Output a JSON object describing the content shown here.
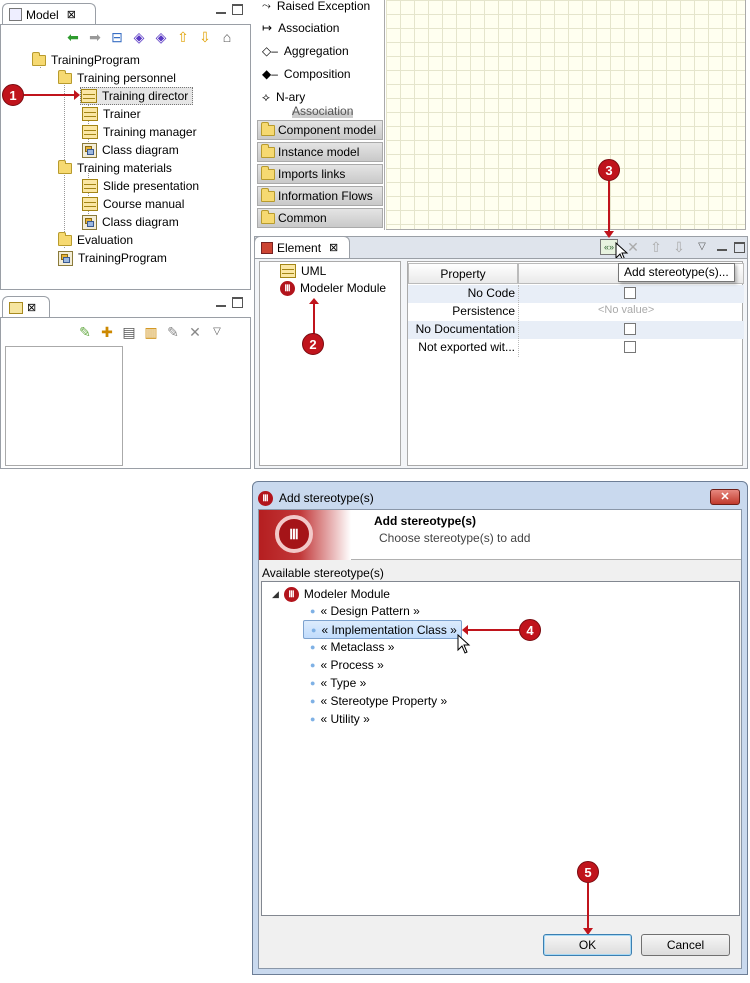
{
  "model_view": {
    "tab_label": "Model",
    "tree": [
      {
        "label": "TrainingProgram",
        "icon": "folder"
      },
      {
        "label": "Training personnel",
        "icon": "folder"
      },
      {
        "label": "Training director",
        "icon": "class"
      },
      {
        "label": "Trainer",
        "icon": "class"
      },
      {
        "label": "Training manager",
        "icon": "class"
      },
      {
        "label": "Class diagram",
        "icon": "diagram"
      },
      {
        "label": "Training materials",
        "icon": "folder"
      },
      {
        "label": "Slide presentation",
        "icon": "class"
      },
      {
        "label": "Course manual",
        "icon": "class"
      },
      {
        "label": "Class diagram",
        "icon": "diagram"
      },
      {
        "label": "Evaluation",
        "icon": "folder"
      },
      {
        "label": "TrainingProgram",
        "icon": "diagram"
      }
    ]
  },
  "palette": {
    "items": [
      "Raised Exception",
      "Association",
      "Aggregation",
      "Composition",
      "N-ary",
      "Association"
    ],
    "categories": [
      "Component model",
      "Instance model",
      "Imports links",
      "Information Flows",
      "Common"
    ]
  },
  "element_view": {
    "tab_label": "Element",
    "tree": [
      "UML",
      "Modeler Module"
    ],
    "table_header": "Property",
    "rows": [
      {
        "label": "No Code",
        "value": ""
      },
      {
        "label": "Persistence",
        "value": "<No value>"
      },
      {
        "label": "No Documentation",
        "value": ""
      },
      {
        "label": "Not exported wit...",
        "value": ""
      }
    ],
    "tooltip": "Add stereotype(s)..."
  },
  "dialog": {
    "title": "Add stereotype(s)",
    "heading": "Add stereotype(s)",
    "subheading": "Choose stereotype(s) to add",
    "section_label": "Available stereotype(s)",
    "root": "Modeler Module",
    "stereotypes": [
      "« Design Pattern »",
      "« Implementation Class »",
      "« Metaclass »",
      "« Process »",
      "« Type »",
      "« Stereotype Property »",
      "« Utility »"
    ],
    "ok_label": "OK",
    "cancel_label": "Cancel",
    "close_glyph": "✕"
  },
  "callouts": [
    "1",
    "2",
    "3",
    "4",
    "5"
  ],
  "colors": {
    "callout": "#c0141c",
    "selection": "#cce4f7",
    "accent": "#b2141c"
  }
}
